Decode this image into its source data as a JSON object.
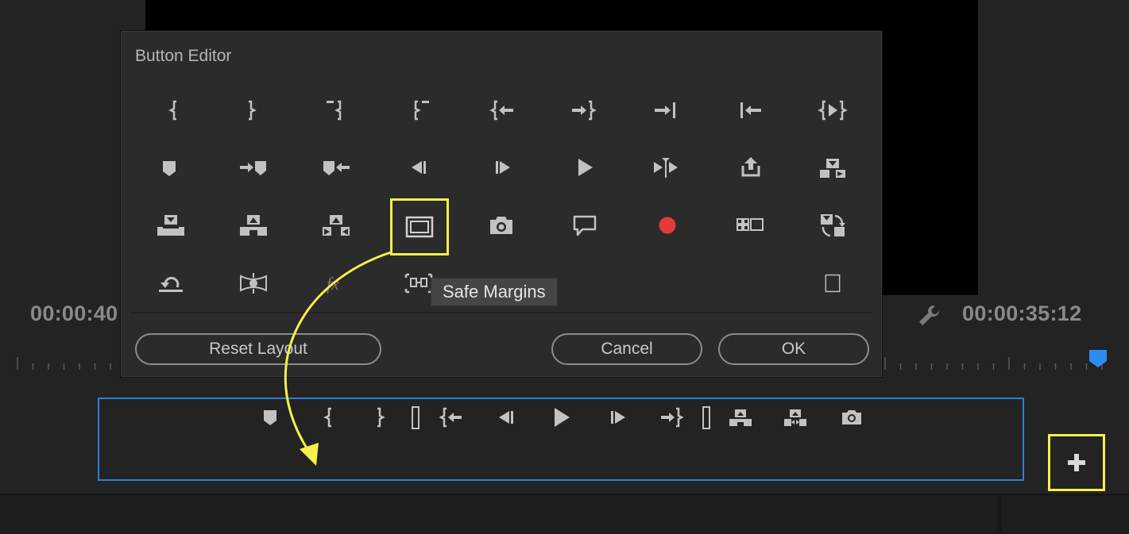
{
  "monitor": {
    "timecode_left": "00:00:40",
    "timecode_right": "00:00:35:12"
  },
  "dialog": {
    "title": "Button Editor",
    "tooltip": "Safe Margins",
    "buttons": {
      "reset": "Reset Layout",
      "cancel": "Cancel",
      "ok": "OK"
    }
  },
  "colors": {
    "highlight": "#f4f04c",
    "record": "#e63a3a",
    "selection_border": "#2c7fd4",
    "playhead": "#2e8cf0"
  },
  "icons": {
    "grid": [
      "mark-in-icon",
      "mark-out-icon",
      "clear-in-icon",
      "clear-out-icon",
      "go-to-in-icon",
      "go-to-out-icon",
      "go-to-next-edit-icon",
      "go-to-previous-edit-icon",
      "play-in-to-out-icon",
      "add-marker-icon",
      "go-to-next-marker-icon",
      "go-to-previous-marker-icon",
      "step-back-icon",
      "step-forward-icon",
      "play-icon",
      "play-around-icon",
      "lift-icon",
      "extract-icon",
      "insert-icon",
      "overwrite-icon",
      "replace-icon",
      "safe-margins-icon",
      "export-frame-icon",
      "comment-icon",
      "record-icon",
      "multi-camera-icon",
      "toggle-proxies-icon",
      "loop-icon",
      "global-fx-mute-icon",
      "fx-icon",
      "compare-view-icon",
      "spacer-icon"
    ],
    "bar": [
      "add-marker-icon",
      "mark-in-icon",
      "mark-out-icon",
      "spacer-icon",
      "go-to-in-icon",
      "step-back-icon",
      "play-icon",
      "step-forward-icon",
      "go-to-out-icon",
      "spacer-icon",
      "lift-icon",
      "extract-icon",
      "export-frame-icon"
    ],
    "add": "plus-icon",
    "settings": "wrench-icon"
  }
}
